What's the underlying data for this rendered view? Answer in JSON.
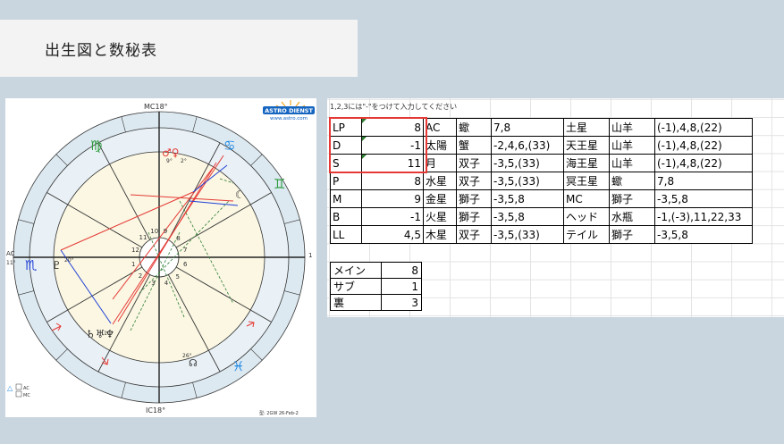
{
  "title": "出生図と数秘表",
  "chart": {
    "brand_top": "ASTRO DIENST",
    "brand_url": "www.astro.com",
    "mc_label": "MC18°",
    "ic_label": "IC18°",
    "ac_label": "AC",
    "ac_deg": "11°",
    "dc_label": "1",
    "footer": "型: 2GW 26-Feb-2",
    "legend_ac": "AC",
    "legend_mc": "MC",
    "sign_virgo": "♍",
    "sign_cancer": "♋",
    "sign_gemini": "♊",
    "sign_scorpio": "♏",
    "sign_pisces": "♓",
    "sign_leo": "♌",
    "planet_mars_venus": "♂♀",
    "planet_pluto": "♇",
    "planet_moon": "☾",
    "planet_saturn_group": "♄♅♆",
    "planet_node": "☊",
    "deg_mars": "9°",
    "deg_venus": "2°",
    "deg_pluto": "20°",
    "deg_saturn": "10°",
    "deg_node": "26°",
    "house_nums": [
      "1",
      "2",
      "3",
      "4",
      "5",
      "6",
      "7",
      "8",
      "9",
      "10",
      "11",
      "12"
    ]
  },
  "sheet": {
    "note": "1,2,3には\"-\"をつけて入力してください",
    "rows": [
      {
        "code": "LP",
        "val": "8",
        "p1": "AC",
        "s1": "蠍",
        "n1": "7,8",
        "p2": "土星",
        "s2": "山羊",
        "n2": "(-1),4,8,(22)"
      },
      {
        "code": "D",
        "val": "-1",
        "p1": "太陽",
        "s1": "蟹",
        "n1": "-2,4,6,(33)",
        "p2": "天王星",
        "s2": "山羊",
        "n2": "(-1),4,8,(22)"
      },
      {
        "code": "S",
        "val": "11",
        "p1": "月",
        "s1": "双子",
        "n1": "-3,5,(33)",
        "p2": "海王星",
        "s2": "山羊",
        "n2": "(-1),4,8,(22)"
      },
      {
        "code": "P",
        "val": "8",
        "p1": "水星",
        "s1": "双子",
        "n1": "-3,5,(33)",
        "p2": "冥王星",
        "s2": "蠍",
        "n2": "7,8"
      },
      {
        "code": "M",
        "val": "9",
        "p1": "金星",
        "s1": "獅子",
        "n1": "-3,5,8",
        "p2": "MC",
        "s2": "獅子",
        "n2": "-3,5,8"
      },
      {
        "code": "B",
        "val": "-1",
        "p1": "火星",
        "s1": "獅子",
        "n1": "-3,5,8",
        "p2": "ヘッド",
        "s2": "水瓶",
        "n2": "-1,(-3),11,22,33"
      },
      {
        "code": "LL",
        "val": "4,5",
        "p1": "木星",
        "s1": "双子",
        "n1": "-3,5,(33)",
        "p2": "テイル",
        "s2": "獅子",
        "n2": "-3,5,8"
      }
    ],
    "summary": [
      {
        "label": "メイン",
        "val": "8"
      },
      {
        "label": "サブ",
        "val": "1"
      },
      {
        "label": "裏",
        "val": "3"
      }
    ]
  }
}
